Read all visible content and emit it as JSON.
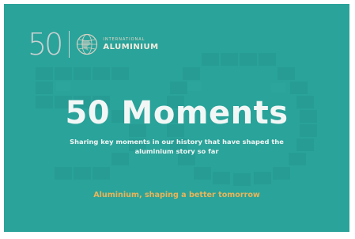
{
  "logo": {
    "anniversary_number": "50",
    "org_line_1": "INTERNATIONAL",
    "org_line_2": "ALUMINIUM"
  },
  "headline": "50 Moments",
  "subtitle": "Sharing key moments in our history that have shaped the aluminium story so far",
  "tagline": "Aluminium, shaping a better tomorrow",
  "colors": {
    "background": "#2aa39a",
    "headline": "#f2f7f6",
    "tagline": "#e9b55a",
    "logo_gold": "#e4d8c5"
  }
}
